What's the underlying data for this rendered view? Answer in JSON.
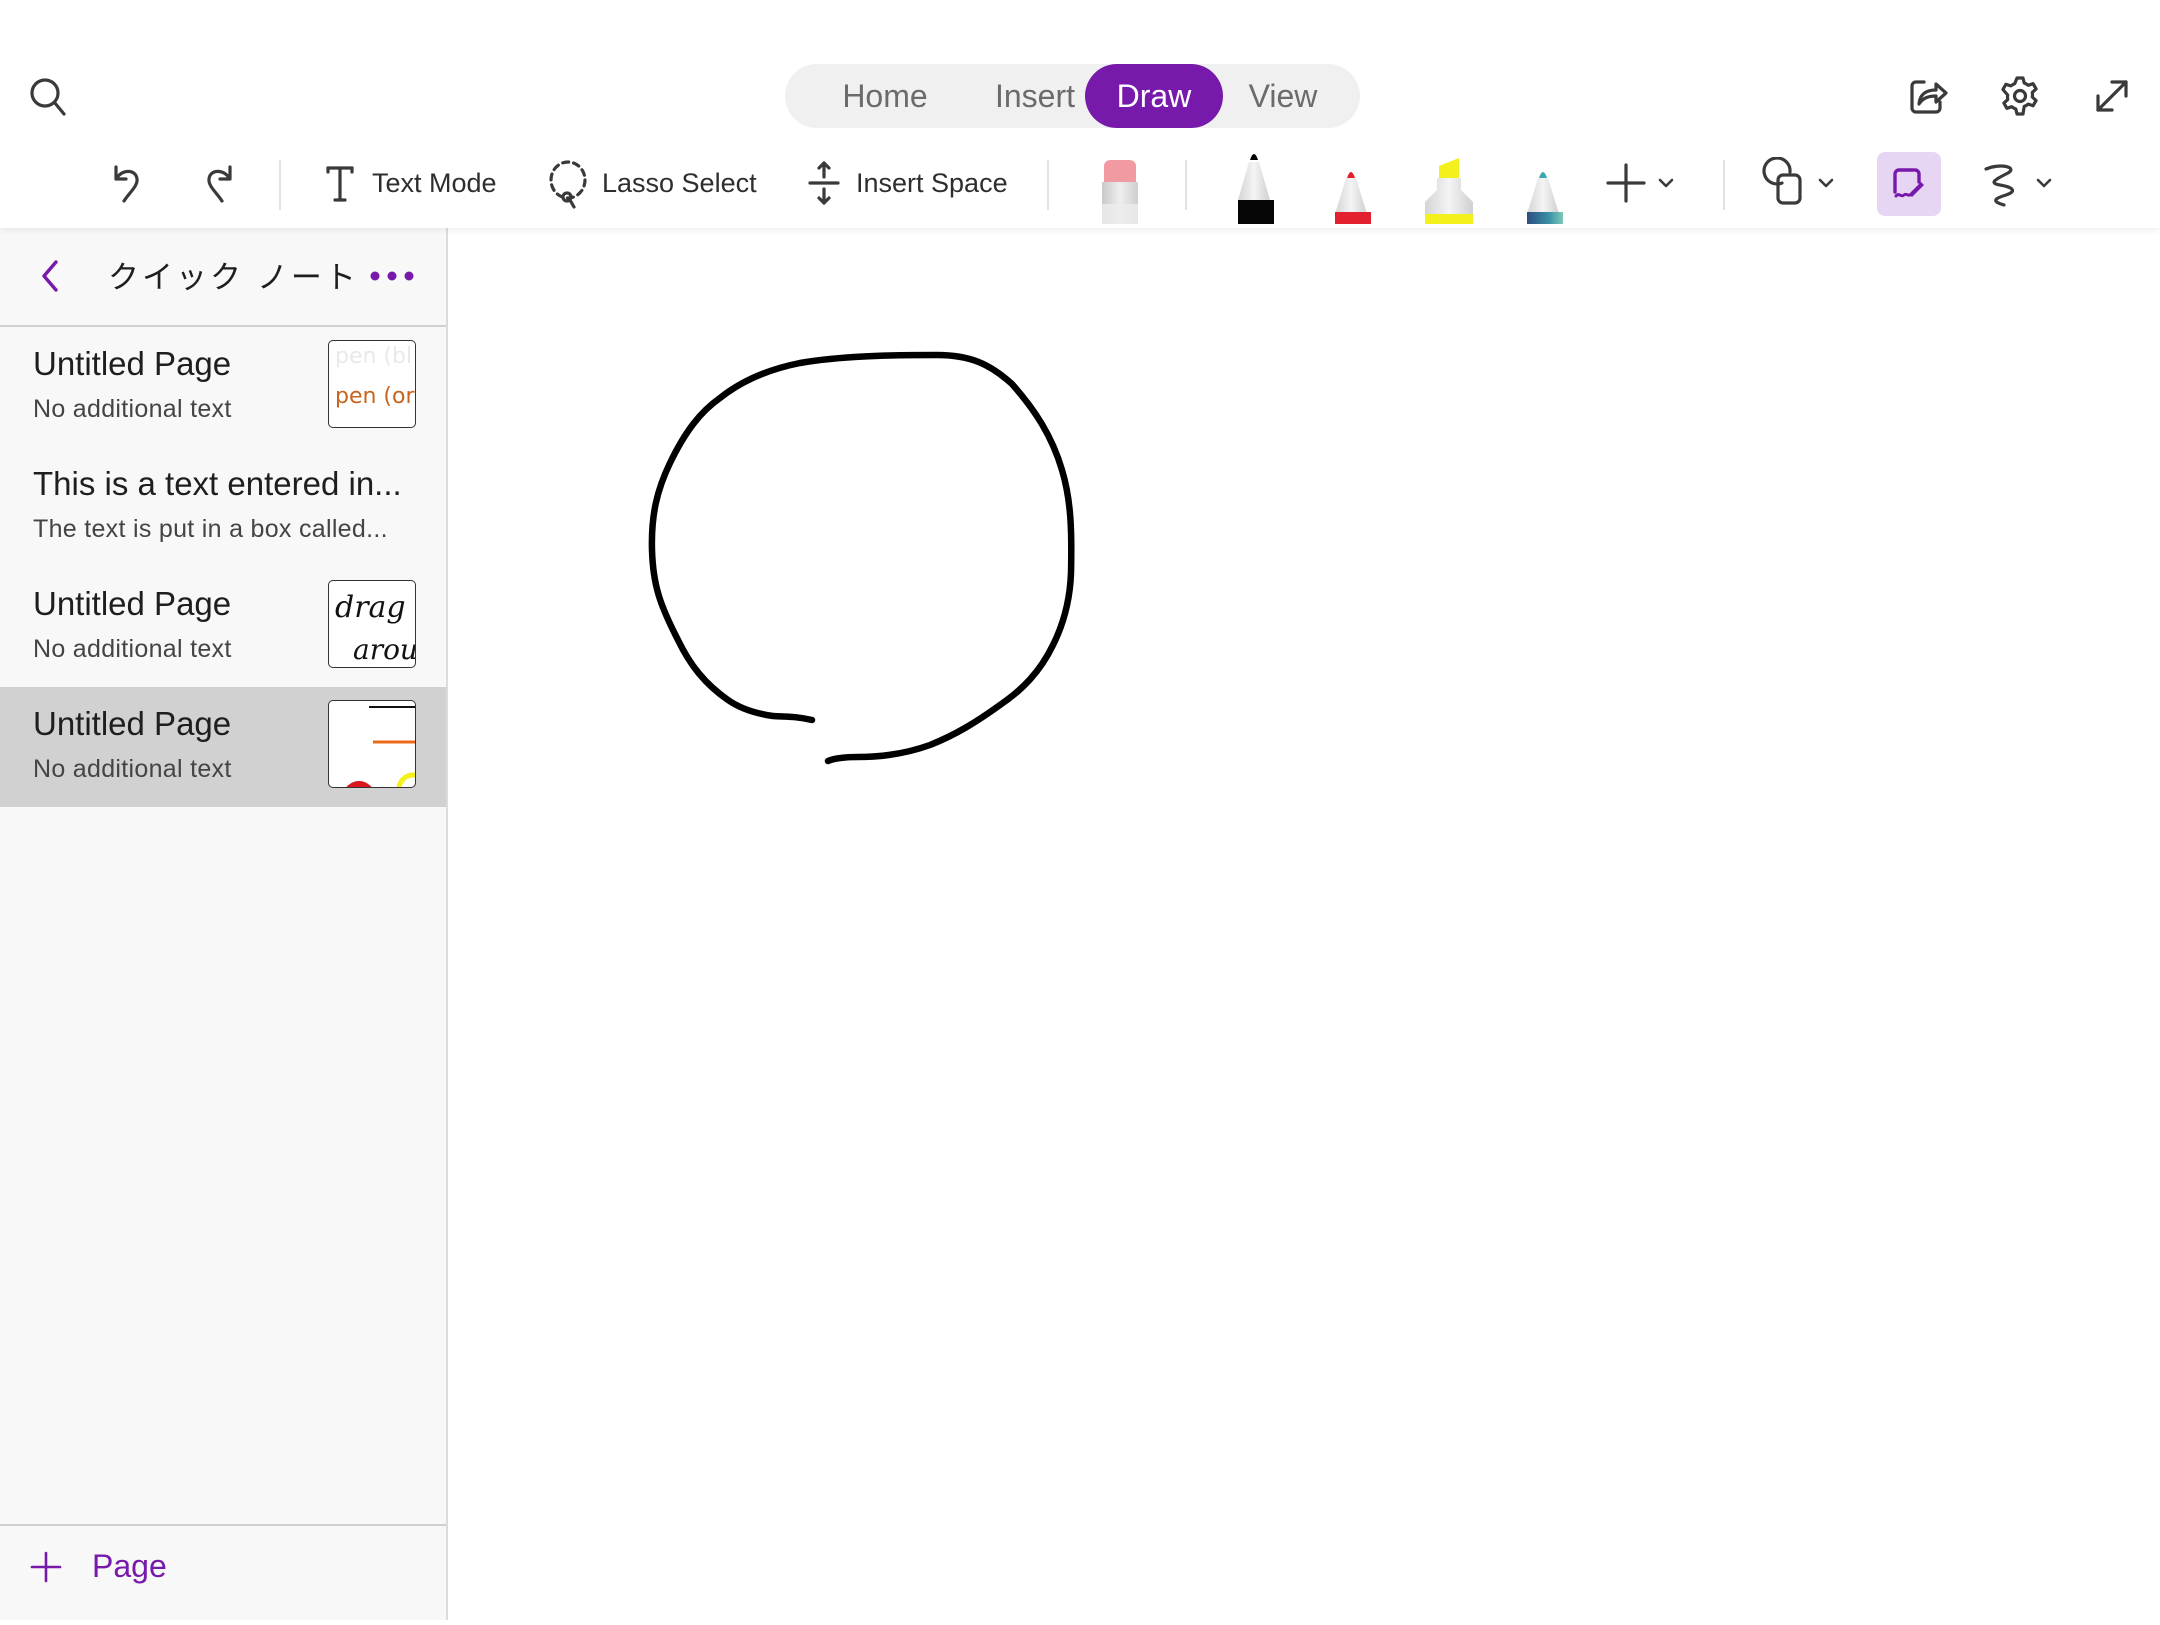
{
  "header": {
    "search_icon": "search-icon",
    "tabs": [
      {
        "label": "Home",
        "active": false
      },
      {
        "label": "Insert",
        "active": false
      },
      {
        "label": "Draw",
        "active": true
      },
      {
        "label": "View",
        "active": false
      }
    ],
    "right_icons": [
      "share-icon",
      "gear-icon",
      "expand-icon"
    ]
  },
  "toolbar": {
    "undo_icon": "undo-icon",
    "redo_icon": "redo-icon",
    "text_mode_label": "Text Mode",
    "lasso_select_label": "Lasso Select",
    "insert_space_label": "Insert Space",
    "pens": [
      {
        "name": "eraser",
        "color": "#f08a95"
      },
      {
        "name": "pen-black",
        "color": "#000000"
      },
      {
        "name": "pen-red",
        "color": "#e3202e"
      },
      {
        "name": "highlighter-yellow",
        "color": "#f4f01c"
      },
      {
        "name": "pen-galaxy",
        "color": "#3aa7b0"
      }
    ],
    "add_pen_icon": "plus-icon",
    "shapes_icon": "shapes-icon",
    "ink_to_shape_icon": "ink-draw-icon",
    "ink_to_shape_active": true,
    "ink_replay_icon": "squiggle-icon"
  },
  "sidebar": {
    "section_title": "クイック ノート",
    "back_icon": "chevron-left-icon",
    "more_icon": "more-icon",
    "pages": [
      {
        "title": "Untitled Page",
        "subtitle": "No additional text",
        "thumb": "pen (bl… / pen (ora…",
        "selected": false
      },
      {
        "title": "This is a text entered in...",
        "subtitle": "The text is put in a box called...",
        "thumb": "",
        "selected": false
      },
      {
        "title": "Untitled Page",
        "subtitle": "No additional text",
        "thumb": "drag / arou…",
        "selected": false
      },
      {
        "title": "Untitled Page",
        "subtitle": "No additional text",
        "thumb": "lines and circles",
        "selected": true
      }
    ],
    "add_page_label": "Page"
  },
  "colors": {
    "accent": "#7719aa",
    "accent_light": "#e6d6f3",
    "selected_row": "#d1d1d1",
    "sidebar_bg": "#f8f8f8",
    "ink": "#000000"
  }
}
